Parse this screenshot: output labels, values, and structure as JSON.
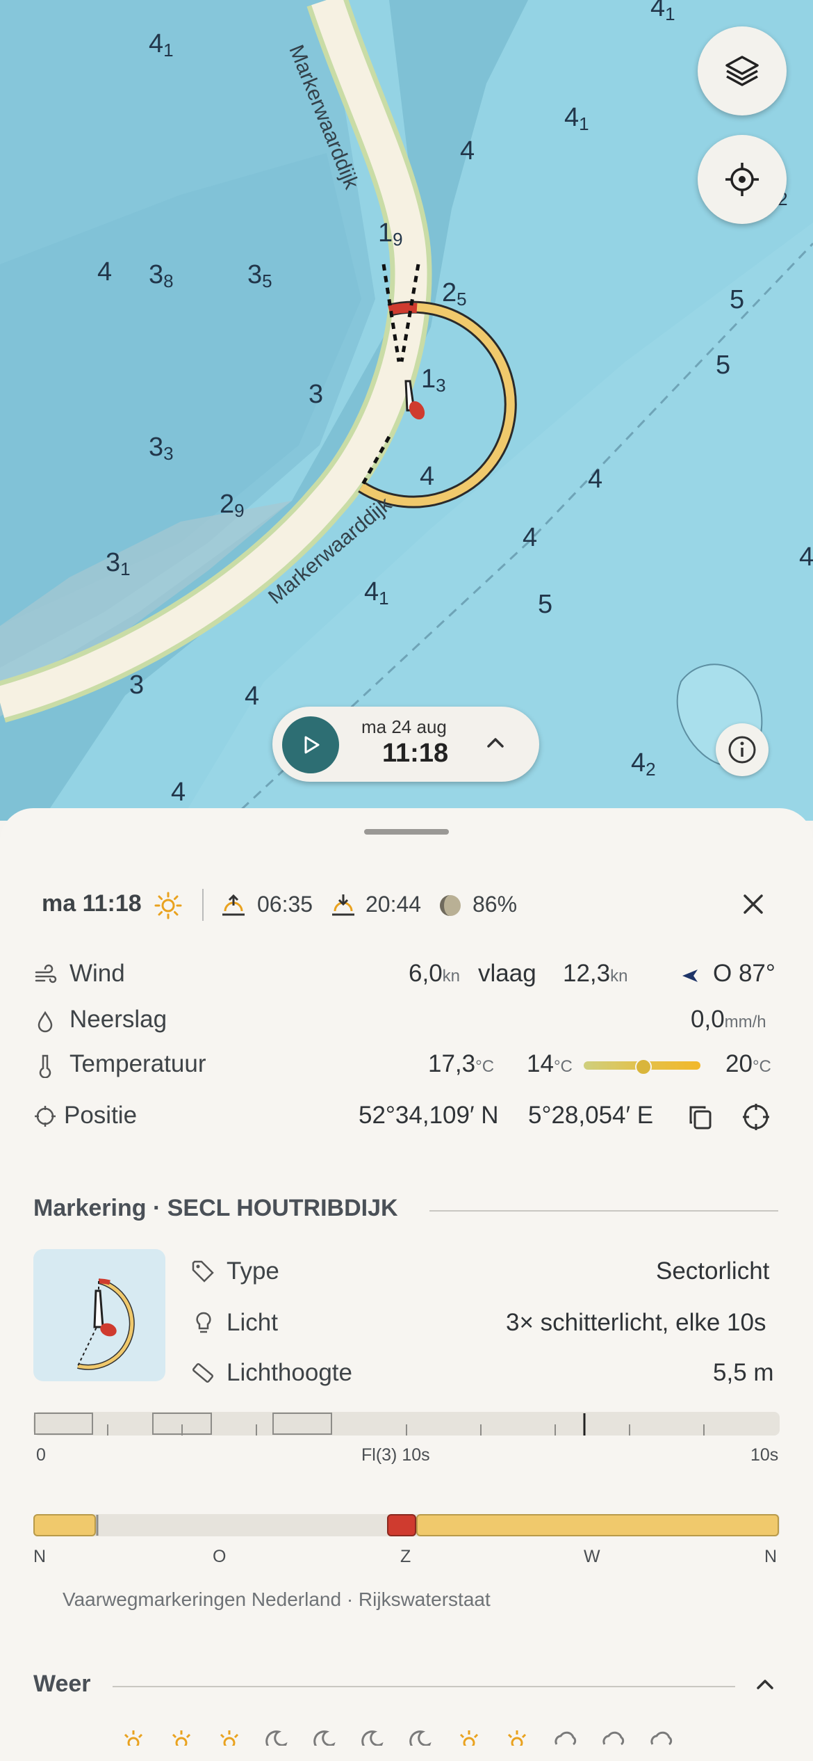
{
  "map": {
    "road_name_top": "Markerwaarddijk",
    "road_name_bottom": "Markerwaarddijk",
    "depths": [
      {
        "v": "4",
        "s": "1"
      },
      {
        "v": "4",
        "s": "1"
      },
      {
        "v": "4",
        "s": "1"
      },
      {
        "v": "4",
        "s": ""
      },
      {
        "v": "4",
        "s": "2"
      },
      {
        "v": "1",
        "s": "9"
      },
      {
        "v": "2",
        "s": "5"
      },
      {
        "v": "3",
        "s": "8"
      },
      {
        "v": "3",
        "s": "5"
      },
      {
        "v": "4",
        "s": ""
      },
      {
        "v": "5",
        "s": ""
      },
      {
        "v": "5",
        "s": ""
      },
      {
        "v": "3",
        "s": ""
      },
      {
        "v": "1",
        "s": "3"
      },
      {
        "v": "3",
        "s": "3"
      },
      {
        "v": "4",
        "s": ""
      },
      {
        "v": "4",
        "s": ""
      },
      {
        "v": "2",
        "s": "9"
      },
      {
        "v": "3",
        "s": "1"
      },
      {
        "v": "4",
        "s": ""
      },
      {
        "v": "4",
        "s": "1"
      },
      {
        "v": "5",
        "s": ""
      },
      {
        "v": "4",
        "s": ""
      },
      {
        "v": "3",
        "s": ""
      },
      {
        "v": "4",
        "s": ""
      },
      {
        "v": "4",
        "s": "2"
      },
      {
        "v": "4",
        "s": ""
      }
    ],
    "layers_icon": "layers-icon",
    "locate_icon": "crosshair-icon",
    "info_icon": "info-icon"
  },
  "timebar": {
    "date": "ma 24 aug",
    "time": "11:18"
  },
  "sheet": {
    "header": {
      "time": "ma 11:18",
      "sunrise": "06:35",
      "sunset": "20:44",
      "moon": "86%"
    },
    "wind": {
      "label": "Wind",
      "speed": "6,0",
      "speed_unit": "kn",
      "gust_label": "vlaag",
      "gust": "12,3",
      "gust_unit": "kn",
      "dir": "O 87°"
    },
    "rain": {
      "label": "Neerslag",
      "value": "0,0",
      "unit": "mm/h"
    },
    "temp": {
      "label": "Temperatuur",
      "value": "17,3",
      "unit": "°C",
      "min": "14",
      "max": "20",
      "range_unit": "°C",
      "position": 0.5
    },
    "position": {
      "label": "Positie",
      "lat": "52°34,109′ N",
      "lon": "5°28,054′ E"
    },
    "marker": {
      "title": "Markering · SECL HOUTRIBDIJK",
      "type_label": "Type",
      "type_value": "Sectorlicht",
      "light_label": "Licht",
      "light_value": "3× schitterlicht, elke 10s",
      "height_label": "Lichthoogte",
      "height_value": "5,5 m",
      "timeline_start": "0",
      "timeline_mid": "Fl(3) 10s",
      "timeline_end": "10s",
      "compass": [
        "N",
        "O",
        "Z",
        "W",
        "N"
      ],
      "source": "Vaarwegmarkeringen Nederland · Rijkswaterstaat"
    },
    "weather_title": "Weer"
  },
  "colors": {
    "water": "#8ecfe0",
    "shallow": "#6fb9cf",
    "accent_teal": "#2d6e73",
    "sector_yellow": "#f0c96c",
    "sector_red": "#cf3b2f"
  }
}
